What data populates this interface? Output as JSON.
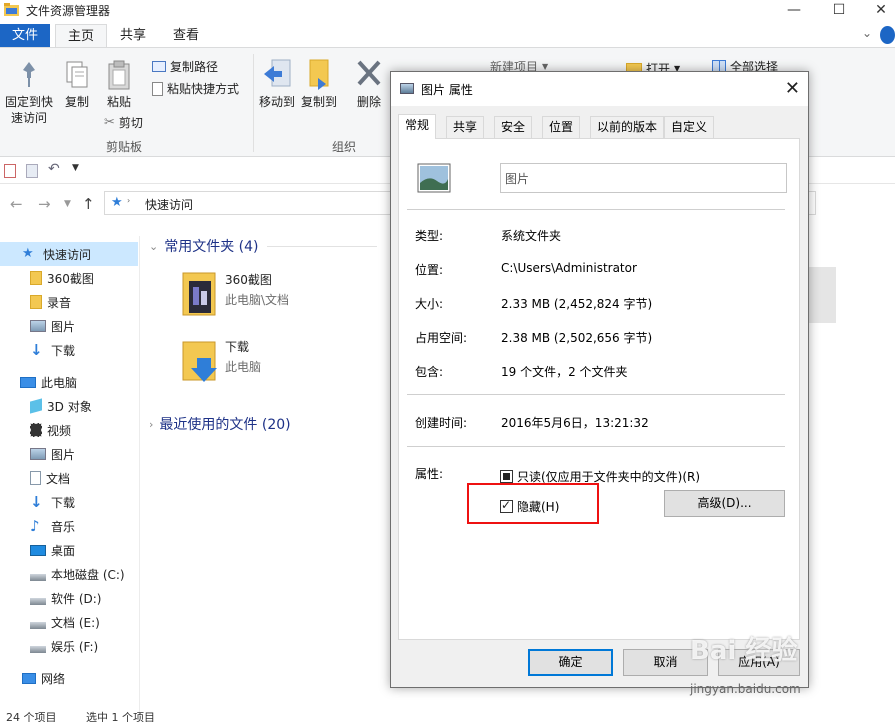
{
  "window": {
    "title": "文件资源管理器",
    "controls": [
      "—",
      "☐",
      "✕"
    ]
  },
  "ribbon": {
    "tabs": [
      "文件",
      "主页",
      "共享",
      "查看"
    ],
    "clipboard": {
      "pin": "固定到快\n速访问",
      "copy": "复制",
      "paste": "粘贴",
      "copy_path": "复制路径",
      "paste_shortcut": "粘贴快捷方式",
      "cut": "剪切",
      "group_label": "剪贴板"
    },
    "organize": {
      "move_to": "移动到",
      "copy_to": "复制到",
      "delete": "删除",
      "group_label": "组织"
    },
    "new_item": "新建项目",
    "open": "打开",
    "select_all": "全部选择"
  },
  "address": {
    "path": "快速访问"
  },
  "nav": {
    "items": [
      {
        "label": "快速访问",
        "icon": "star-icon",
        "level": 0
      },
      {
        "label": "360截图",
        "icon": "folder-icon",
        "level": 1
      },
      {
        "label": "录音",
        "icon": "folder-icon",
        "level": 1
      },
      {
        "label": "图片",
        "icon": "pictures-icon",
        "level": 1
      },
      {
        "label": "下载",
        "icon": "download-icon",
        "level": 1
      },
      {
        "label": "此电脑",
        "icon": "computer-icon",
        "level": 0
      },
      {
        "label": "3D 对象",
        "icon": "3d-objects-icon",
        "level": 1
      },
      {
        "label": "视频",
        "icon": "video-icon",
        "level": 1
      },
      {
        "label": "图片",
        "icon": "pictures-icon",
        "level": 1
      },
      {
        "label": "文档",
        "icon": "document-icon",
        "level": 1
      },
      {
        "label": "下载",
        "icon": "download-icon",
        "level": 1
      },
      {
        "label": "音乐",
        "icon": "music-icon",
        "level": 1
      },
      {
        "label": "桌面",
        "icon": "desktop-icon",
        "level": 1
      },
      {
        "label": "本地磁盘 (C:)",
        "icon": "drive-icon",
        "level": 1
      },
      {
        "label": "软件 (D:)",
        "icon": "drive-icon",
        "level": 1
      },
      {
        "label": "文档 (E:)",
        "icon": "drive-icon",
        "level": 1
      },
      {
        "label": "娱乐 (F:)",
        "icon": "drive-icon",
        "level": 1
      },
      {
        "label": "网络",
        "icon": "network-icon",
        "level": 0
      }
    ]
  },
  "content": {
    "frequent_header": "常用文件夹 (4)",
    "recent_header": "最近使用的文件 (20)",
    "folders": [
      {
        "name": "360截图",
        "location": "此电脑\\文档"
      },
      {
        "name": "下载",
        "location": "此电脑"
      }
    ]
  },
  "status": {
    "items_count": "24 个项目",
    "selected": "选中 1 个项目"
  },
  "dialog": {
    "title": "图片 属性",
    "tabs": [
      "常规",
      "共享",
      "安全",
      "位置",
      "以前的版本",
      "自定义"
    ],
    "name_value": "图片",
    "rows": [
      {
        "label": "类型:",
        "value": "系统文件夹"
      },
      {
        "label": "位置:",
        "value": "C:\\Users\\Administrator"
      },
      {
        "label": "大小:",
        "value": "2.33 MB (2,452,824 字节)"
      },
      {
        "label": "占用空间:",
        "value": "2.38 MB (2,502,656 字节)"
      },
      {
        "label": "包含:",
        "value": "19 个文件，2 个文件夹"
      }
    ],
    "created_label": "创建时间:",
    "created_value": "2016年5月6日，13:21:32",
    "attributes_label": "属性:",
    "readonly_label": "只读(仅应用于文件夹中的文件)(R)",
    "hidden_label": "隐藏(H)",
    "advanced_button": "高级(D)...",
    "ok_button": "确定",
    "cancel_button": "取消",
    "apply_button": "应用(A)"
  },
  "watermark": {
    "brand": "Bai 经验",
    "url": "jingyan.baidu.com"
  },
  "colors": {
    "file_tab": "#1c66c5",
    "selection": "#cce8ff",
    "section_header": "#1e3287",
    "highlight_box": "#e11111",
    "primary_button_border": "#0078d7"
  }
}
